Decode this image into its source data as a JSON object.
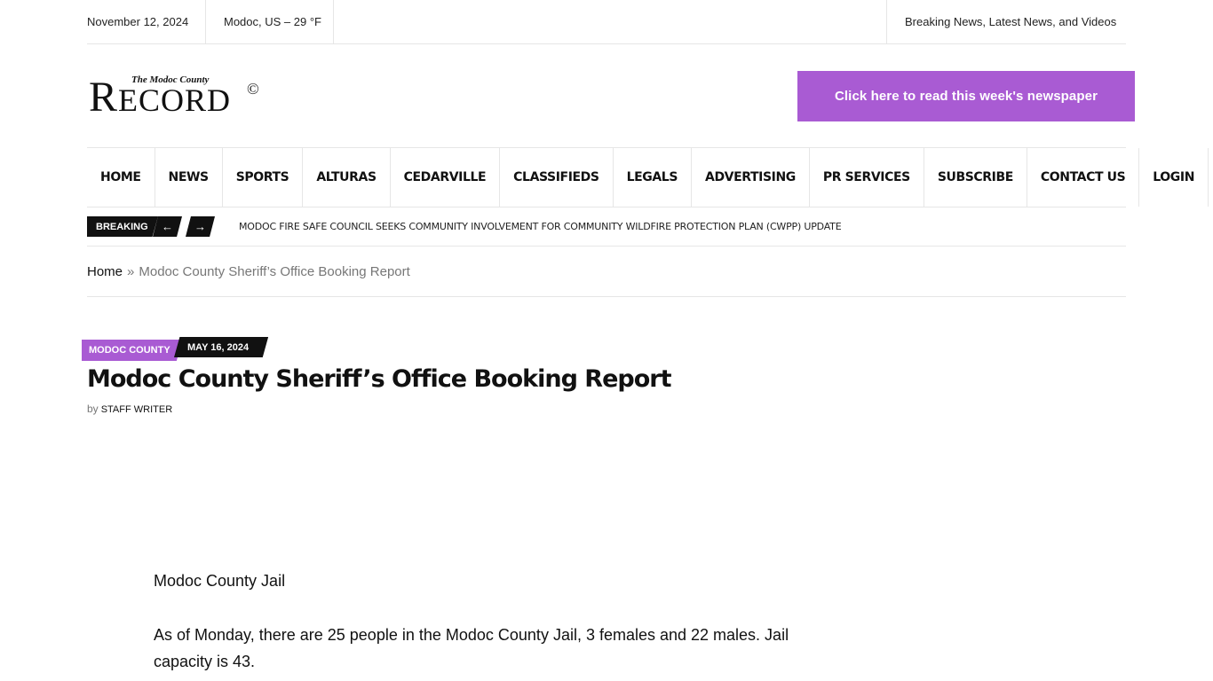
{
  "topbar": {
    "date": "November 12, 2024",
    "weather": "Modoc, US – 29 °F",
    "tagline": "Breaking News, Latest News, and Videos"
  },
  "logo": {
    "small": "The Modoc County",
    "big_first": "R",
    "big_rest": "ECORD",
    "copyright": "©"
  },
  "paper_button": "Click here to read this week's newspaper",
  "nav": [
    "HOME",
    "NEWS",
    "SPORTS",
    "ALTURAS",
    "CEDARVILLE",
    "CLASSIFIEDS",
    "LEGALS",
    "ADVERTISING",
    "PR SERVICES",
    "SUBSCRIBE",
    "CONTACT US",
    "LOGIN"
  ],
  "breaking": {
    "label": "BREAKING",
    "prev_icon": "←",
    "next_icon": "→",
    "headline": "MODOC FIRE SAFE COUNCIL SEEKS COMMUNITY INVOLVEMENT FOR COMMUNITY WILDFIRE PROTECTION PLAN (CWPP) UPDATE"
  },
  "breadcrumb": {
    "home": "Home",
    "separator": "»",
    "current": "Modoc County Sheriff’s Office Booking Report"
  },
  "article": {
    "category": "MODOC COUNTY",
    "date": "MAY 16, 2024",
    "title": "Modoc County Sheriff’s Office Booking Report",
    "by": "by",
    "author": "STAFF WRITER",
    "paragraphs": [
      "Modoc County Jail",
      "As of Monday, there are 25 people in the Modoc County Jail, 3 females and 22 males. Jail capacity is 43."
    ]
  },
  "colors": {
    "accent": "#a95bd3",
    "dark": "#111111"
  }
}
